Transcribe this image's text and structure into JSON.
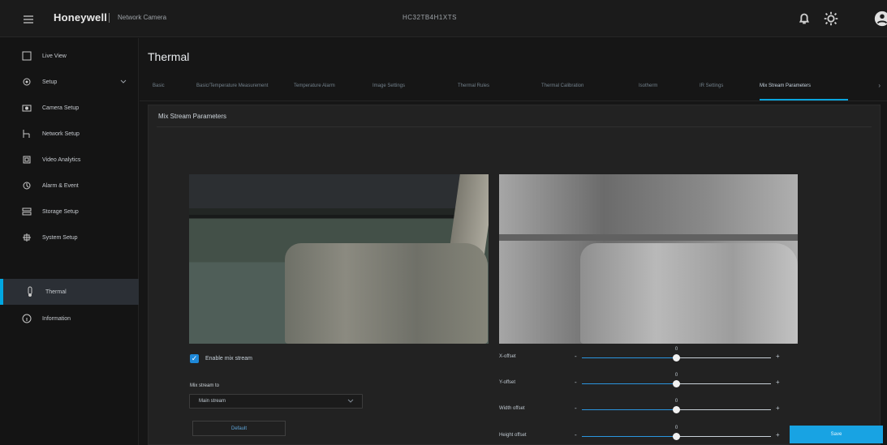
{
  "topbar": {
    "brand": "Honeywell",
    "product": "Network Camera",
    "model": "HC32TB4H1XTS",
    "icons": [
      "menu-icon",
      "bell-icon",
      "settings-icon",
      "user-icon"
    ]
  },
  "sidebar": {
    "items": [
      {
        "label": "Live View",
        "icon": "live-view-icon"
      },
      {
        "label": "Setup",
        "icon": "gear-icon"
      },
      {
        "label": "Camera Setup",
        "icon": "camera-icon"
      },
      {
        "label": "Network Setup",
        "icon": "network-icon"
      },
      {
        "label": "Video Analytics",
        "icon": "analytics-icon"
      },
      {
        "label": "Alarm & Event",
        "icon": "alarm-icon"
      },
      {
        "label": "Storage Setup",
        "icon": "storage-icon"
      },
      {
        "label": "System Setup",
        "icon": "system-icon"
      },
      {
        "label": "Thermal",
        "icon": "thermal-icon"
      },
      {
        "label": "Information",
        "icon": "info-icon"
      }
    ]
  },
  "main": {
    "page_title": "Thermal",
    "tabs": [
      "Basic",
      "Basic/Temperature Measurement",
      "Temperature Alarm",
      "Image Settings",
      "Thermal Rules",
      "Thermal Calibration",
      "Isotherm",
      "IR Settings",
      "Mix Stream Parameters"
    ],
    "active_tab": "Mix Stream Parameters",
    "panel_title": "Mix Stream Parameters"
  },
  "mix_stream": {
    "checkbox_label": "Enable mix stream",
    "checkbox_checked": true,
    "select_label": "Mix stream to",
    "select_value": "Main stream",
    "outline_button": "Default",
    "primary_button": "Save"
  },
  "sliders": [
    {
      "label": "X-offset",
      "value": "0",
      "min": "-",
      "max": "+",
      "fraction": 0.5
    },
    {
      "label": "Y-offset",
      "value": "0",
      "min": "-",
      "max": "+",
      "fraction": 0.5
    },
    {
      "label": "Width offset",
      "value": "0",
      "min": "-",
      "max": "+",
      "fraction": 0.5
    },
    {
      "label": "Height offset",
      "value": "0",
      "min": "-",
      "max": "+",
      "fraction": 0.5
    }
  ],
  "colors": {
    "accent": "#18a3e3",
    "background": "#161616",
    "panel": "#222222"
  }
}
